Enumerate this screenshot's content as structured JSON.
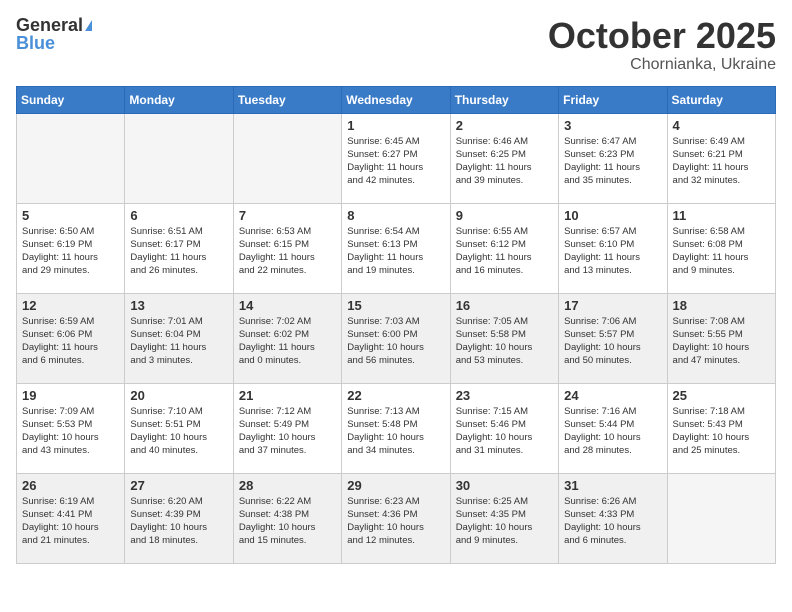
{
  "header": {
    "logo_general": "General",
    "logo_blue": "Blue",
    "month": "October 2025",
    "location": "Chornianka, Ukraine"
  },
  "weekdays": [
    "Sunday",
    "Monday",
    "Tuesday",
    "Wednesday",
    "Thursday",
    "Friday",
    "Saturday"
  ],
  "weeks": [
    [
      {
        "day": "",
        "empty": true
      },
      {
        "day": "",
        "empty": true
      },
      {
        "day": "",
        "empty": true
      },
      {
        "day": "1",
        "info": "Sunrise: 6:45 AM\nSunset: 6:27 PM\nDaylight: 11 hours\nand 42 minutes."
      },
      {
        "day": "2",
        "info": "Sunrise: 6:46 AM\nSunset: 6:25 PM\nDaylight: 11 hours\nand 39 minutes."
      },
      {
        "day": "3",
        "info": "Sunrise: 6:47 AM\nSunset: 6:23 PM\nDaylight: 11 hours\nand 35 minutes."
      },
      {
        "day": "4",
        "info": "Sunrise: 6:49 AM\nSunset: 6:21 PM\nDaylight: 11 hours\nand 32 minutes."
      }
    ],
    [
      {
        "day": "5",
        "info": "Sunrise: 6:50 AM\nSunset: 6:19 PM\nDaylight: 11 hours\nand 29 minutes."
      },
      {
        "day": "6",
        "info": "Sunrise: 6:51 AM\nSunset: 6:17 PM\nDaylight: 11 hours\nand 26 minutes."
      },
      {
        "day": "7",
        "info": "Sunrise: 6:53 AM\nSunset: 6:15 PM\nDaylight: 11 hours\nand 22 minutes."
      },
      {
        "day": "8",
        "info": "Sunrise: 6:54 AM\nSunset: 6:13 PM\nDaylight: 11 hours\nand 19 minutes."
      },
      {
        "day": "9",
        "info": "Sunrise: 6:55 AM\nSunset: 6:12 PM\nDaylight: 11 hours\nand 16 minutes."
      },
      {
        "day": "10",
        "info": "Sunrise: 6:57 AM\nSunset: 6:10 PM\nDaylight: 11 hours\nand 13 minutes."
      },
      {
        "day": "11",
        "info": "Sunrise: 6:58 AM\nSunset: 6:08 PM\nDaylight: 11 hours\nand 9 minutes."
      }
    ],
    [
      {
        "day": "12",
        "shaded": true,
        "info": "Sunrise: 6:59 AM\nSunset: 6:06 PM\nDaylight: 11 hours\nand 6 minutes."
      },
      {
        "day": "13",
        "shaded": true,
        "info": "Sunrise: 7:01 AM\nSunset: 6:04 PM\nDaylight: 11 hours\nand 3 minutes."
      },
      {
        "day": "14",
        "shaded": true,
        "info": "Sunrise: 7:02 AM\nSunset: 6:02 PM\nDaylight: 11 hours\nand 0 minutes."
      },
      {
        "day": "15",
        "shaded": true,
        "info": "Sunrise: 7:03 AM\nSunset: 6:00 PM\nDaylight: 10 hours\nand 56 minutes."
      },
      {
        "day": "16",
        "shaded": true,
        "info": "Sunrise: 7:05 AM\nSunset: 5:58 PM\nDaylight: 10 hours\nand 53 minutes."
      },
      {
        "day": "17",
        "shaded": true,
        "info": "Sunrise: 7:06 AM\nSunset: 5:57 PM\nDaylight: 10 hours\nand 50 minutes."
      },
      {
        "day": "18",
        "shaded": true,
        "info": "Sunrise: 7:08 AM\nSunset: 5:55 PM\nDaylight: 10 hours\nand 47 minutes."
      }
    ],
    [
      {
        "day": "19",
        "info": "Sunrise: 7:09 AM\nSunset: 5:53 PM\nDaylight: 10 hours\nand 43 minutes."
      },
      {
        "day": "20",
        "info": "Sunrise: 7:10 AM\nSunset: 5:51 PM\nDaylight: 10 hours\nand 40 minutes."
      },
      {
        "day": "21",
        "info": "Sunrise: 7:12 AM\nSunset: 5:49 PM\nDaylight: 10 hours\nand 37 minutes."
      },
      {
        "day": "22",
        "info": "Sunrise: 7:13 AM\nSunset: 5:48 PM\nDaylight: 10 hours\nand 34 minutes."
      },
      {
        "day": "23",
        "info": "Sunrise: 7:15 AM\nSunset: 5:46 PM\nDaylight: 10 hours\nand 31 minutes."
      },
      {
        "day": "24",
        "info": "Sunrise: 7:16 AM\nSunset: 5:44 PM\nDaylight: 10 hours\nand 28 minutes."
      },
      {
        "day": "25",
        "info": "Sunrise: 7:18 AM\nSunset: 5:43 PM\nDaylight: 10 hours\nand 25 minutes."
      }
    ],
    [
      {
        "day": "26",
        "shaded": true,
        "info": "Sunrise: 6:19 AM\nSunset: 4:41 PM\nDaylight: 10 hours\nand 21 minutes."
      },
      {
        "day": "27",
        "shaded": true,
        "info": "Sunrise: 6:20 AM\nSunset: 4:39 PM\nDaylight: 10 hours\nand 18 minutes."
      },
      {
        "day": "28",
        "shaded": true,
        "info": "Sunrise: 6:22 AM\nSunset: 4:38 PM\nDaylight: 10 hours\nand 15 minutes."
      },
      {
        "day": "29",
        "shaded": true,
        "info": "Sunrise: 6:23 AM\nSunset: 4:36 PM\nDaylight: 10 hours\nand 12 minutes."
      },
      {
        "day": "30",
        "shaded": true,
        "info": "Sunrise: 6:25 AM\nSunset: 4:35 PM\nDaylight: 10 hours\nand 9 minutes."
      },
      {
        "day": "31",
        "shaded": true,
        "info": "Sunrise: 6:26 AM\nSunset: 4:33 PM\nDaylight: 10 hours\nand 6 minutes."
      },
      {
        "day": "",
        "empty": true
      }
    ]
  ]
}
